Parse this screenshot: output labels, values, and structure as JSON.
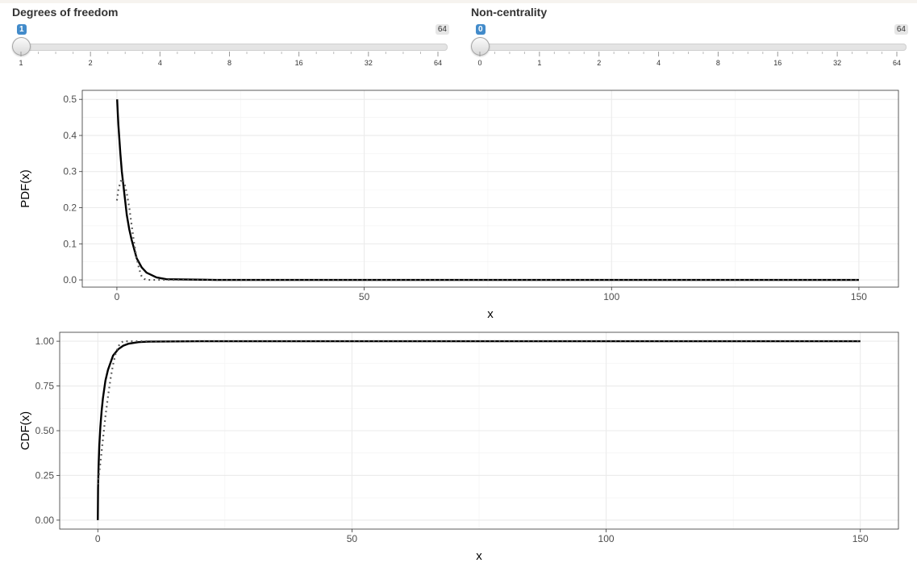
{
  "sliders": [
    {
      "label": "Degrees of freedom",
      "value": "1",
      "max_label": "64",
      "scale": "log2",
      "ticks": [
        "1",
        "2",
        "4",
        "8",
        "16",
        "32",
        "64"
      ],
      "minor_ticks_per_interval": 4
    },
    {
      "label": "Non-centrality",
      "value": "0",
      "max_label": "64",
      "scale": "log2",
      "ticks": [
        "0",
        "1",
        "2",
        "4",
        "8",
        "16",
        "32",
        "64"
      ],
      "minor_ticks_per_interval": 4
    }
  ],
  "chart_data": [
    {
      "type": "line",
      "xlabel": "x",
      "ylabel": "PDF(x)",
      "xlim": [
        -7,
        158
      ],
      "ylim": [
        -0.02,
        0.525
      ],
      "xticks": [
        0,
        50,
        100,
        150
      ],
      "yticks": [
        0.0,
        0.1,
        0.2,
        0.3,
        0.4,
        0.5
      ],
      "ytick_labels": [
        "0.0",
        "0.1",
        "0.2",
        "0.3",
        "0.4",
        "0.5"
      ],
      "grid": true,
      "series": [
        {
          "style": "solid",
          "color": "#000000",
          "x": [
            0.05,
            0.15,
            0.3,
            0.5,
            0.7,
            1.0,
            1.5,
            2.0,
            2.5,
            3.0,
            4.0,
            5.0,
            6.0,
            8.0,
            10.0,
            20.0,
            50.0,
            100.0,
            150.0
          ],
          "y": [
            0.5,
            0.47,
            0.43,
            0.39,
            0.35,
            0.3,
            0.24,
            0.18,
            0.14,
            0.11,
            0.06,
            0.035,
            0.02,
            0.007,
            0.002,
            0.0,
            0.0,
            0.0,
            0.0
          ]
        },
        {
          "style": "dotted",
          "color": "#555555",
          "x": [
            0.0,
            0.3,
            0.7,
            1.0,
            1.5,
            2.0,
            2.5,
            3.0,
            3.5,
            4.0,
            4.5,
            5.0,
            5.5,
            6.0,
            8.0,
            10.0,
            50.0,
            100.0,
            150.0
          ],
          "y": [
            0.22,
            0.25,
            0.27,
            0.28,
            0.27,
            0.24,
            0.2,
            0.15,
            0.1,
            0.06,
            0.03,
            0.01,
            0.003,
            0.0,
            0.0,
            0.0,
            0.0,
            0.0,
            0.0
          ]
        }
      ]
    },
    {
      "type": "line",
      "xlabel": "x",
      "ylabel": "CDF(x)",
      "xlim": [
        -7.5,
        157.5
      ],
      "ylim": [
        -0.05,
        1.05
      ],
      "xticks": [
        0,
        50,
        100,
        150
      ],
      "yticks": [
        0.0,
        0.25,
        0.5,
        0.75,
        1.0
      ],
      "ytick_labels": [
        "0.00",
        "0.25",
        "0.50",
        "0.75",
        "1.00"
      ],
      "grid": true,
      "series": [
        {
          "style": "solid",
          "color": "#000000",
          "x": [
            0.0,
            0.05,
            0.15,
            0.3,
            0.5,
            0.75,
            1.0,
            1.5,
            2.0,
            3.0,
            4.0,
            5.0,
            6.0,
            8.0,
            10.0,
            20.0,
            50.0,
            100.0,
            150.0
          ],
          "y": [
            0.0,
            0.18,
            0.3,
            0.42,
            0.52,
            0.61,
            0.68,
            0.78,
            0.84,
            0.92,
            0.955,
            0.975,
            0.986,
            0.995,
            0.998,
            1.0,
            1.0,
            1.0,
            1.0
          ]
        },
        {
          "style": "dotted",
          "color": "#555555",
          "x": [
            0.0,
            0.5,
            1.0,
            1.5,
            2.0,
            2.5,
            3.0,
            3.5,
            4.0,
            4.5,
            5.0,
            6.0,
            8.0,
            10.0,
            50.0,
            100.0,
            150.0
          ],
          "y": [
            0.2,
            0.32,
            0.45,
            0.58,
            0.69,
            0.79,
            0.87,
            0.93,
            0.97,
            0.99,
            1.0,
            1.0,
            1.0,
            1.0,
            1.0,
            1.0,
            1.0
          ]
        }
      ]
    }
  ]
}
